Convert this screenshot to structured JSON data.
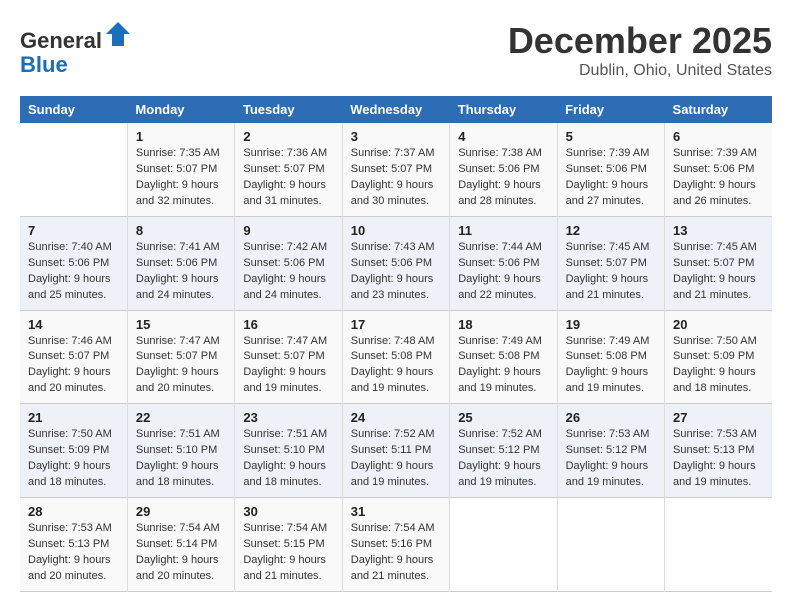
{
  "header": {
    "logo_line1": "General",
    "logo_line2": "Blue",
    "month": "December 2025",
    "location": "Dublin, Ohio, United States"
  },
  "weekdays": [
    "Sunday",
    "Monday",
    "Tuesday",
    "Wednesday",
    "Thursday",
    "Friday",
    "Saturday"
  ],
  "weeks": [
    [
      {
        "day": "",
        "info": ""
      },
      {
        "day": "1",
        "info": "Sunrise: 7:35 AM\nSunset: 5:07 PM\nDaylight: 9 hours\nand 32 minutes."
      },
      {
        "day": "2",
        "info": "Sunrise: 7:36 AM\nSunset: 5:07 PM\nDaylight: 9 hours\nand 31 minutes."
      },
      {
        "day": "3",
        "info": "Sunrise: 7:37 AM\nSunset: 5:07 PM\nDaylight: 9 hours\nand 30 minutes."
      },
      {
        "day": "4",
        "info": "Sunrise: 7:38 AM\nSunset: 5:06 PM\nDaylight: 9 hours\nand 28 minutes."
      },
      {
        "day": "5",
        "info": "Sunrise: 7:39 AM\nSunset: 5:06 PM\nDaylight: 9 hours\nand 27 minutes."
      },
      {
        "day": "6",
        "info": "Sunrise: 7:39 AM\nSunset: 5:06 PM\nDaylight: 9 hours\nand 26 minutes."
      }
    ],
    [
      {
        "day": "7",
        "info": "Sunrise: 7:40 AM\nSunset: 5:06 PM\nDaylight: 9 hours\nand 25 minutes."
      },
      {
        "day": "8",
        "info": "Sunrise: 7:41 AM\nSunset: 5:06 PM\nDaylight: 9 hours\nand 24 minutes."
      },
      {
        "day": "9",
        "info": "Sunrise: 7:42 AM\nSunset: 5:06 PM\nDaylight: 9 hours\nand 24 minutes."
      },
      {
        "day": "10",
        "info": "Sunrise: 7:43 AM\nSunset: 5:06 PM\nDaylight: 9 hours\nand 23 minutes."
      },
      {
        "day": "11",
        "info": "Sunrise: 7:44 AM\nSunset: 5:06 PM\nDaylight: 9 hours\nand 22 minutes."
      },
      {
        "day": "12",
        "info": "Sunrise: 7:45 AM\nSunset: 5:07 PM\nDaylight: 9 hours\nand 21 minutes."
      },
      {
        "day": "13",
        "info": "Sunrise: 7:45 AM\nSunset: 5:07 PM\nDaylight: 9 hours\nand 21 minutes."
      }
    ],
    [
      {
        "day": "14",
        "info": "Sunrise: 7:46 AM\nSunset: 5:07 PM\nDaylight: 9 hours\nand 20 minutes."
      },
      {
        "day": "15",
        "info": "Sunrise: 7:47 AM\nSunset: 5:07 PM\nDaylight: 9 hours\nand 20 minutes."
      },
      {
        "day": "16",
        "info": "Sunrise: 7:47 AM\nSunset: 5:07 PM\nDaylight: 9 hours\nand 19 minutes."
      },
      {
        "day": "17",
        "info": "Sunrise: 7:48 AM\nSunset: 5:08 PM\nDaylight: 9 hours\nand 19 minutes."
      },
      {
        "day": "18",
        "info": "Sunrise: 7:49 AM\nSunset: 5:08 PM\nDaylight: 9 hours\nand 19 minutes."
      },
      {
        "day": "19",
        "info": "Sunrise: 7:49 AM\nSunset: 5:08 PM\nDaylight: 9 hours\nand 19 minutes."
      },
      {
        "day": "20",
        "info": "Sunrise: 7:50 AM\nSunset: 5:09 PM\nDaylight: 9 hours\nand 18 minutes."
      }
    ],
    [
      {
        "day": "21",
        "info": "Sunrise: 7:50 AM\nSunset: 5:09 PM\nDaylight: 9 hours\nand 18 minutes."
      },
      {
        "day": "22",
        "info": "Sunrise: 7:51 AM\nSunset: 5:10 PM\nDaylight: 9 hours\nand 18 minutes."
      },
      {
        "day": "23",
        "info": "Sunrise: 7:51 AM\nSunset: 5:10 PM\nDaylight: 9 hours\nand 18 minutes."
      },
      {
        "day": "24",
        "info": "Sunrise: 7:52 AM\nSunset: 5:11 PM\nDaylight: 9 hours\nand 19 minutes."
      },
      {
        "day": "25",
        "info": "Sunrise: 7:52 AM\nSunset: 5:12 PM\nDaylight: 9 hours\nand 19 minutes."
      },
      {
        "day": "26",
        "info": "Sunrise: 7:53 AM\nSunset: 5:12 PM\nDaylight: 9 hours\nand 19 minutes."
      },
      {
        "day": "27",
        "info": "Sunrise: 7:53 AM\nSunset: 5:13 PM\nDaylight: 9 hours\nand 19 minutes."
      }
    ],
    [
      {
        "day": "28",
        "info": "Sunrise: 7:53 AM\nSunset: 5:13 PM\nDaylight: 9 hours\nand 20 minutes."
      },
      {
        "day": "29",
        "info": "Sunrise: 7:54 AM\nSunset: 5:14 PM\nDaylight: 9 hours\nand 20 minutes."
      },
      {
        "day": "30",
        "info": "Sunrise: 7:54 AM\nSunset: 5:15 PM\nDaylight: 9 hours\nand 21 minutes."
      },
      {
        "day": "31",
        "info": "Sunrise: 7:54 AM\nSunset: 5:16 PM\nDaylight: 9 hours\nand 21 minutes."
      },
      {
        "day": "",
        "info": ""
      },
      {
        "day": "",
        "info": ""
      },
      {
        "day": "",
        "info": ""
      }
    ]
  ]
}
